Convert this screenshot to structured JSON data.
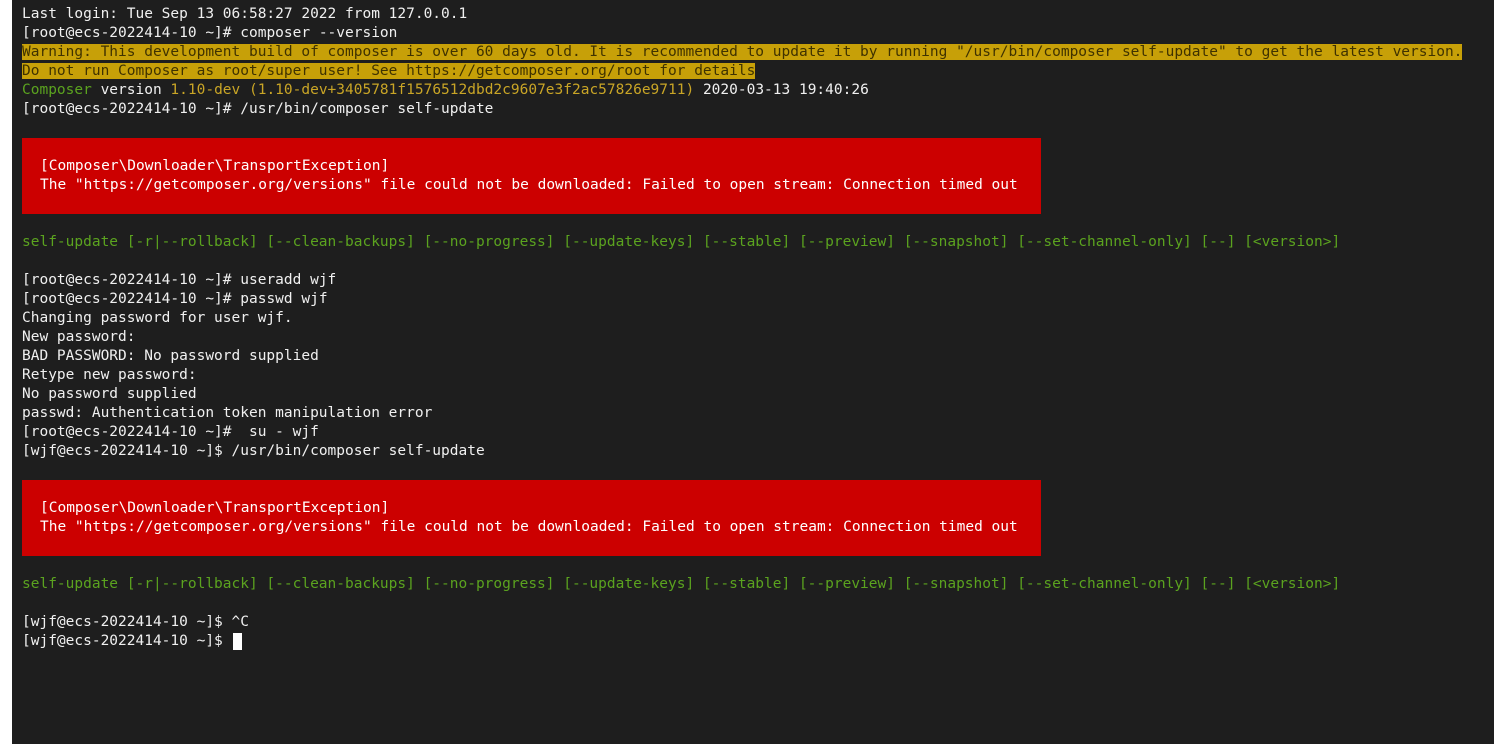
{
  "terminal": {
    "last_login": "Last login: Tue Sep 13 06:58:27 2022 from 127.0.0.1",
    "prompt_root": "[root@ecs-2022414-10 ~]# ",
    "prompt_wjf": "[wjf@ecs-2022414-10 ~]$ ",
    "cmd_composer_version": "composer --version",
    "warning_line1": "Warning: This development build of composer is over 60 days old. It is recommended to update it by running \"/usr/bin/composer self-update\" to get the latest version.",
    "warning_line2": "Do not run Composer as root/super user! See https://getcomposer.org/root for details",
    "version_word_composer": "Composer",
    "version_word_version": " version ",
    "version_number": "1.10-dev (1.10-dev+3405781f1576512dbd2c9607e3f2ac57826e9711)",
    "version_date": " 2020-03-13 19:40:26",
    "cmd_self_update": "/usr/bin/composer self-update",
    "error_title": "[Composer\\Downloader\\TransportException]",
    "error_message": "The \"https://getcomposer.org/versions\" file could not be downloaded: Failed to open stream: Connection timed out",
    "usage_line": "self-update [-r|--rollback] [--clean-backups] [--no-progress] [--update-keys] [--stable] [--preview] [--snapshot] [--set-channel-only] [--] [<version>]",
    "cmd_useradd": "useradd wjf",
    "cmd_passwd": "passwd wjf",
    "passwd_changing": "Changing password for user wjf.",
    "passwd_new": "New password:",
    "passwd_bad": "BAD PASSWORD: No password supplied",
    "passwd_retype": "Retype new password:",
    "passwd_none": "No password supplied",
    "passwd_error": "passwd: Authentication token manipulation error",
    "cmd_su": " su - wjf",
    "cmd_ctrl_c": "^C"
  },
  "colors": {
    "background": "#1e1e1e",
    "text": "#f0f0f0",
    "warning_bg": "#c7a008",
    "error_bg": "#cc0000",
    "green": "#5ba31f",
    "yellow": "#c9a526"
  }
}
